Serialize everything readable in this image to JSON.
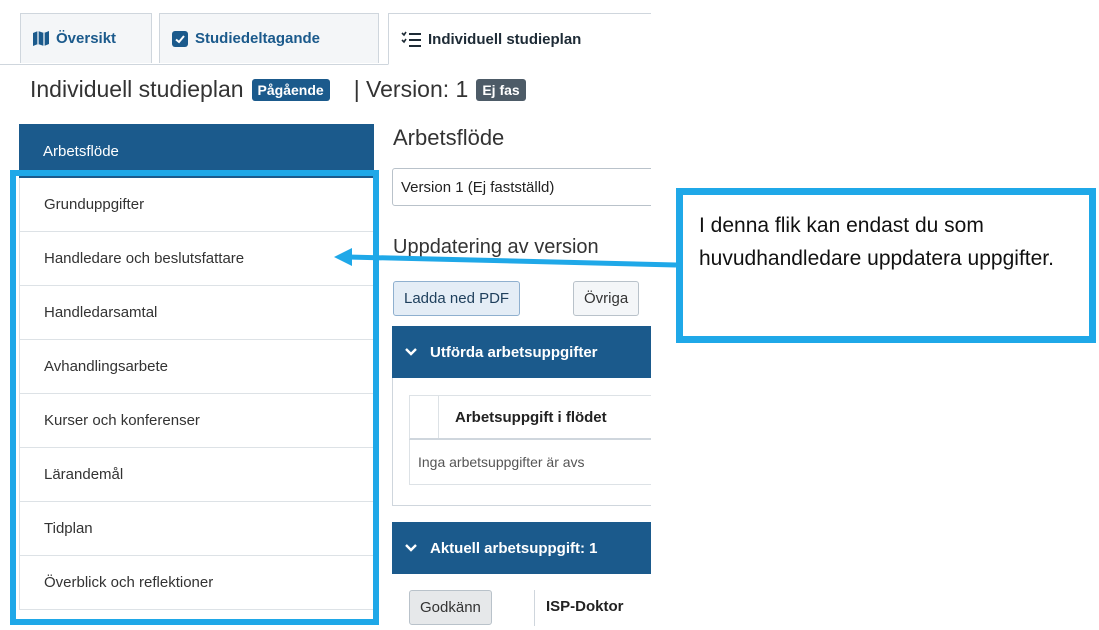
{
  "tabs": [
    {
      "label": "Översikt",
      "icon": "map-icon"
    },
    {
      "label": "Studiedeltagande",
      "icon": "checkbox-icon"
    },
    {
      "label": "Individuell studieplan",
      "icon": "list-icon"
    }
  ],
  "heading": {
    "title": "Individuell studieplan",
    "status_badge": "Pågående",
    "separator": "| Version: 1",
    "version_badge": "Ej fas"
  },
  "sidebar": {
    "active": "Arbetsflöde",
    "items": [
      "Grunduppgifter",
      "Handledare och beslutsfattare",
      "Handledarsamtal",
      "Avhandlingsarbete",
      "Kurser och konferenser",
      "Lärandemål",
      "Tidplan",
      "Överblick och reflektioner"
    ]
  },
  "main": {
    "title": "Arbetsflöde",
    "version_select": "Version 1 (Ej fastställd)",
    "update_title": "Uppdatering av version",
    "download_pdf": "Ladda ned PDF",
    "other_button": "Övriga",
    "panel1_title": "Utförda arbetsuppgifter",
    "table_header": "Arbetsuppgift i flödet",
    "table_empty": "Inga arbetsuppgifter är avs",
    "panel2_title": "Aktuell arbetsuppgift: 1",
    "approve_button": "Godkänn",
    "isp_label": "ISP-Doktor"
  },
  "annotation": {
    "callout_text": "I denna flik kan endast du som huvudhandledare uppdatera uppgifter.",
    "highlight_color": "#1fa8e8"
  },
  "colors": {
    "primary": "#1b5a8c",
    "version_badge": "#4d5b67"
  }
}
